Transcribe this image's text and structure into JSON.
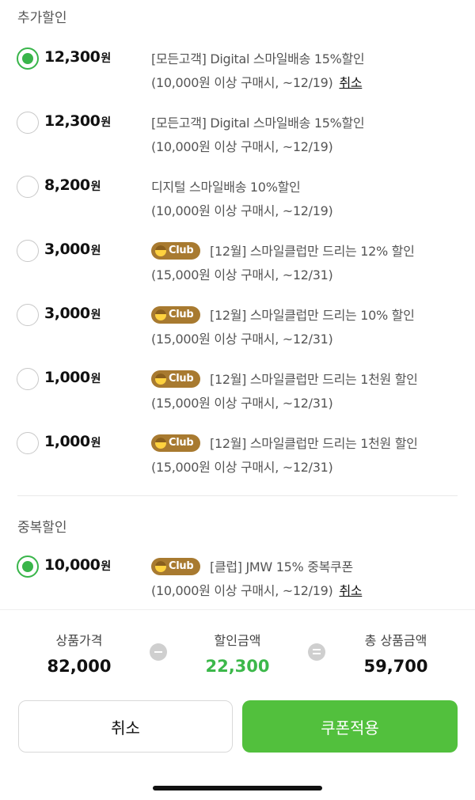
{
  "sections": {
    "additional_title": "추가할인",
    "overlap_title": "중복할인"
  },
  "additional_discounts": [
    {
      "selected": true,
      "amount": "12,300",
      "unit": "원",
      "club": false,
      "title": "[모든고객] Digital 스마일배송 15%할인",
      "condition": "(10,000원 이상 구매시, ~12/19)",
      "cancel": "취소"
    },
    {
      "selected": false,
      "amount": "12,300",
      "unit": "원",
      "club": false,
      "title": "[모든고객] Digital 스마일배송 15%할인",
      "condition": "(10,000원 이상 구매시, ~12/19)",
      "cancel": ""
    },
    {
      "selected": false,
      "amount": "8,200",
      "unit": "원",
      "club": false,
      "title": "디지털 스마일배송 10%할인",
      "condition": "(10,000원 이상 구매시, ~12/19)",
      "cancel": ""
    },
    {
      "selected": false,
      "amount": "3,000",
      "unit": "원",
      "club": true,
      "title": "[12월] 스마일클럽만 드리는 12% 할인",
      "condition": "(15,000원 이상 구매시, ~12/31)",
      "cancel": ""
    },
    {
      "selected": false,
      "amount": "3,000",
      "unit": "원",
      "club": true,
      "title": "[12월] 스마일클럽만 드리는 10% 할인",
      "condition": "(15,000원 이상 구매시, ~12/31)",
      "cancel": ""
    },
    {
      "selected": false,
      "amount": "1,000",
      "unit": "원",
      "club": true,
      "title": "[12월] 스마일클럽만 드리는 1천원 할인",
      "condition": "(15,000원 이상 구매시, ~12/31)",
      "cancel": ""
    },
    {
      "selected": false,
      "amount": "1,000",
      "unit": "원",
      "club": true,
      "title": "[12월] 스마일클럽만 드리는 1천원 할인",
      "condition": "(15,000원 이상 구매시, ~12/31)",
      "cancel": ""
    }
  ],
  "overlap_discounts": [
    {
      "selected": true,
      "amount": "10,000",
      "unit": "원",
      "club": true,
      "title": "[클럽] JMW 15% 중복쿠폰",
      "condition": "(10,000원 이상 구매시, ~12/19)",
      "cancel": "취소"
    }
  ],
  "club_badge_label": "Club",
  "summary": {
    "price_label": "상품가격",
    "price_value": "82,000",
    "discount_label": "할인금액",
    "discount_value": "22,300",
    "total_label": "총 상품금액",
    "total_value": "59,700"
  },
  "buttons": {
    "cancel": "취소",
    "apply": "쿠폰적용"
  },
  "colors": {
    "accent_green": "#52c03d",
    "club_badge": "#a87a30"
  }
}
